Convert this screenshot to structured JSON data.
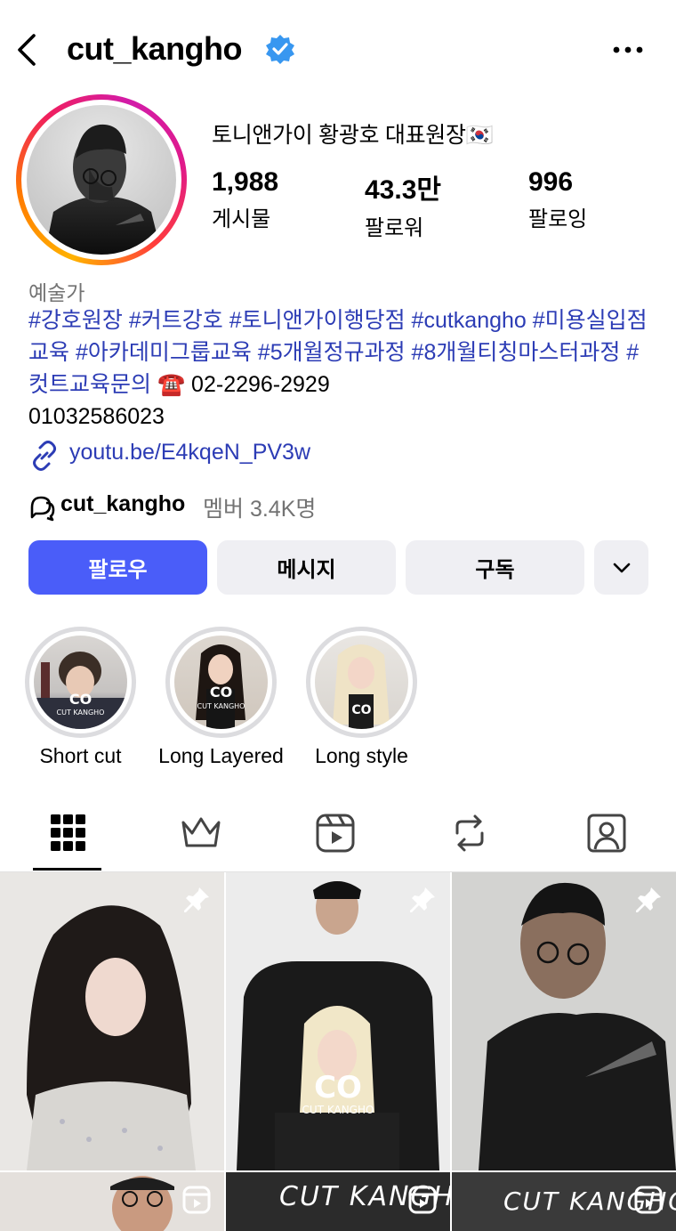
{
  "header": {
    "username": "cut_kangho",
    "verified": true
  },
  "profile": {
    "display_name": "토니앤가이  황광호 대표원장🇰🇷",
    "stats": [
      {
        "value": "1,988",
        "label": "게시물"
      },
      {
        "value": "43.3만",
        "label": "팔로워"
      },
      {
        "value": "996",
        "label": "팔로잉"
      }
    ],
    "category": "예술가",
    "bio": {
      "hashtags_line1": "#강호원장 #커트강호 #토니앤가이행당점 #cutkangho #미용실입점교육 #아카데미그룹교육  #5개월정규과정 #8개월티칭마스터과정 #컷트교육문의",
      "phone_icon": "☎️",
      "phone": " 02-2296-2929",
      "mobile": "01032586023"
    },
    "link": "youtu.be/E4kqeN_PV3w",
    "channel": {
      "name": "cut_kangho",
      "meta": "멤버 3.4K명"
    }
  },
  "actions": {
    "follow": "팔로우",
    "message": "메시지",
    "subscribe": "구독"
  },
  "highlights": [
    {
      "label": "Short cut",
      "wm": "CO",
      "wm_sub": "CUT KANGHO"
    },
    {
      "label": "Long Layered",
      "wm": "CO",
      "wm_sub": "CUT KANGHO"
    },
    {
      "label": "Long style",
      "wm": "CO",
      "wm_sub": ""
    }
  ],
  "grid": {
    "watermark_main": "CO",
    "watermark_sub": "CUT KANGHO",
    "reel_banner": "CUT KANGHO"
  },
  "colors": {
    "follow_button": "#4a5df9",
    "link": "#2c3cb5",
    "verified": "#3897f0"
  }
}
